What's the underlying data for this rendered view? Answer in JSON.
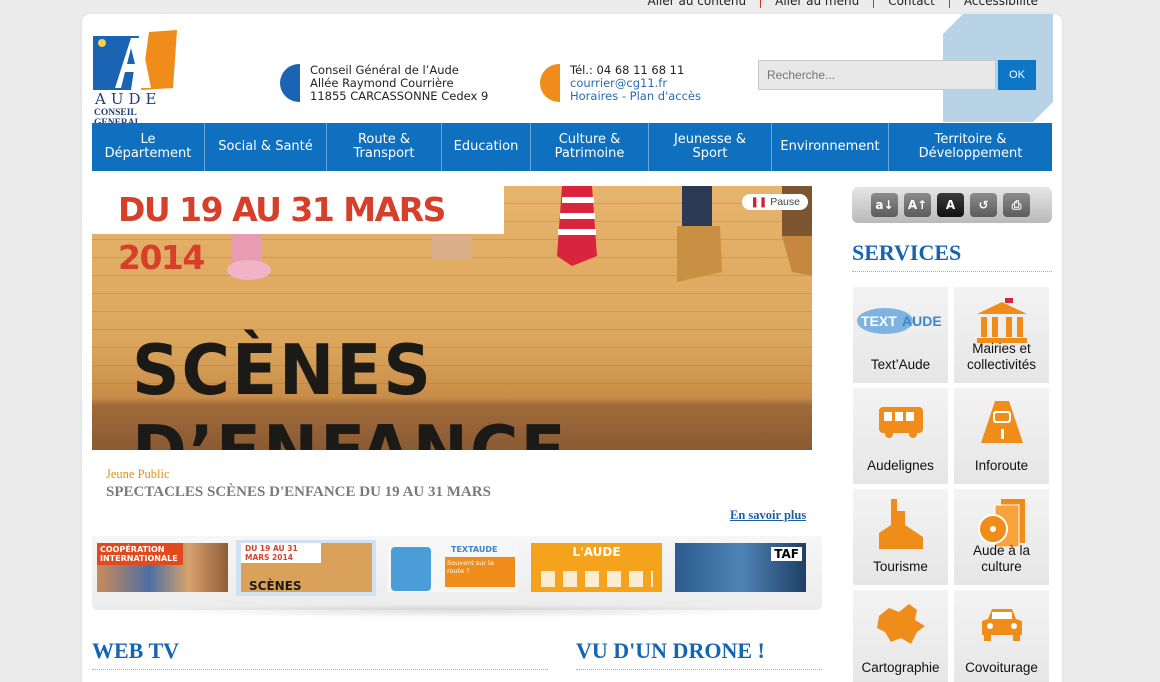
{
  "top_links": [
    "Aller au contenu",
    "Aller au menu",
    "Contact",
    "Accessibilité"
  ],
  "logo": {
    "name": "AUDE",
    "sub": "CONSEIL GENERAL"
  },
  "address": {
    "line1": "Conseil Général de l’Aude",
    "line2": "Allée Raymond Courrière",
    "line3": "11855 CARCASSONNE Cedex 9"
  },
  "contact": {
    "phone": "Tél.: 04 68 11 68 11",
    "email": "courrier@cg11.fr",
    "hours": "Horaires - Plan d'accès"
  },
  "search": {
    "placeholder": "Recherche...",
    "button": "OK"
  },
  "nav": [
    {
      "line1": "Le",
      "line2": "Département"
    },
    {
      "line1": "Social & Santé",
      "line2": ""
    },
    {
      "line1": "Route &",
      "line2": "Transport"
    },
    {
      "line1": "Education",
      "line2": ""
    },
    {
      "line1": "Culture &",
      "line2": "Patrimoine"
    },
    {
      "line1": "Jeunesse &",
      "line2": "Sport"
    },
    {
      "line1": "Environnement",
      "line2": ""
    },
    {
      "line1": "Territoire &",
      "line2": "Développement"
    }
  ],
  "slider": {
    "date_banner": "DU 19 AU 31 MARS 2014",
    "pause_label": "Pause",
    "big_title": "SCÈNES D’ENFANCE",
    "category": "Jeune Public",
    "title": "SPECTACLES SCÈNES D'ENFANCE DU 19 AU 31 MARS",
    "more": "En savoir plus"
  },
  "thumbnails": [
    {
      "text1": "COOPÉRATION",
      "text2": "INTERNATIONALE"
    },
    {
      "text1": "DU 19 AU 31 MARS 2014",
      "text2": "SCÈNES D’ENFANCE"
    },
    {
      "text1": "TEXTAUDE",
      "text2": "Souvent sur la route ?"
    },
    {
      "text1": "L'AUDE",
      "text2": ""
    },
    {
      "text1": "TAF",
      "text2": ""
    }
  ],
  "sections": {
    "webtv": "WEB TV",
    "drone": "VU D'UN DRONE !",
    "services": "SERVICES"
  },
  "tools": [
    "a↓",
    "A↑",
    "A",
    "↺",
    "⎙"
  ],
  "services": [
    {
      "label": "Text’Aude",
      "icon": "textaude-logo-icon"
    },
    {
      "label": "Mairies et collectivités",
      "icon": "town-hall-icon"
    },
    {
      "label": "Audelignes",
      "icon": "bus-icon"
    },
    {
      "label": "Inforoute",
      "icon": "car-road-icon"
    },
    {
      "label": "Tourisme",
      "icon": "castle-icon"
    },
    {
      "label": "Aude à la culture",
      "icon": "cd-books-icon"
    },
    {
      "label": "Cartographie",
      "icon": "map-icon"
    },
    {
      "label": "Covoiturage",
      "icon": "car-icon"
    }
  ],
  "colors": {
    "nav_blue": "#0f70bf",
    "orange": "#f08c1a",
    "title_blue": "#1464b4"
  }
}
